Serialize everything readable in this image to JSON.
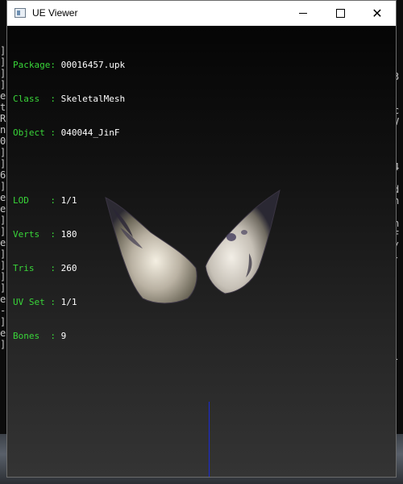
{
  "window": {
    "title": "UE Viewer"
  },
  "titlebar_buttons": {
    "minimize": "minimize",
    "maximize": "maximize",
    "close": "close"
  },
  "info": {
    "package_key": "Package:",
    "package": "00016457.upk",
    "class_key": "Class  :",
    "class": "SkeletalMesh",
    "object_key": "Object :",
    "object": "040044_JinF",
    "lod_key": "LOD    :",
    "lod": "1/1",
    "verts_key": "Verts  :",
    "verts": "180",
    "tris_key": "Tris   :",
    "tris": "260",
    "uvset_key": "UV Set :",
    "uvset": "1/1",
    "bones_key": "Bones  :",
    "bones": "9"
  },
  "colors": {
    "key_text": "#39d639",
    "value_text": "#ffffff",
    "axis": "#1a2bd6"
  },
  "background_console": {
    "left": [
      "]",
      "]",
      "]",
      "]",
      "e",
      "t",
      "R",
      "n",
      "0",
      "]",
      "]",
      "6",
      "]",
      "e",
      "e",
      "]",
      "]",
      "e",
      "]",
      "]",
      "]",
      "]",
      "e",
      "-",
      "]",
      "e",
      "]"
    ],
    "right": [
      "3",
      "",
      "",
      "c",
      "V",
      "",
      "",
      "",
      "4",
      "",
      "d",
      "n",
      "",
      "n",
      "F",
      "/",
      "-",
      "",
      "",
      "",
      "",
      "",
      "",
      "",
      "",
      "-",
      "",
      "",
      ""
    ]
  }
}
